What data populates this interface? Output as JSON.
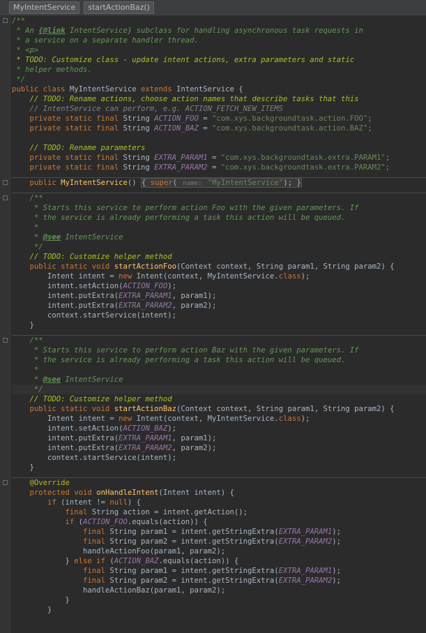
{
  "breadcrumbs": {
    "class_name": "MyIntentService",
    "method_name": "startActionBaz()"
  },
  "code": {
    "l1": "/**",
    "l2a": " * An ",
    "l2b": "{@link",
    "l2c": " IntentService}",
    "l2d": " subclass for handling asynchronous task requests in",
    "l3": " * a service on a separate handler thread.",
    "l4": " * <p>",
    "l5": " * TODO: Customize class - update intent actions, extra parameters and static",
    "l6": " * helper methods.",
    "l7": " */",
    "kw_public_class": "public class ",
    "class_name": "MyIntentService",
    "kw_extends": " extends ",
    "super_class": "IntentService {",
    "todo_rename_actions": "    // TODO: Rename actions, choose action names that describe tasks that this",
    "cm_intentservice": "    // IntentService can perform, e.g. ACTION_FETCH_NEW_ITEMS",
    "kw_psf": "    private static final ",
    "type_string": "String ",
    "action_foo": "ACTION_FOO",
    "action_baz": "ACTION_BAZ",
    "eq": " = ",
    "str_action_foo": "\"com.xys.backgroundtask.action.FOO\"",
    "str_action_baz": "\"com.xys.backgroundtask.action.BAZ\"",
    "semi": ";",
    "todo_rename_params": "    // TODO: Rename parameters",
    "extra_param1": "EXTRA_PARAM1",
    "extra_param2": "EXTRA_PARAM2",
    "str_param1": "\"com.xys.backgroundtask.extra.PARAM1\"",
    "str_param2": "\"com.xys.backgroundtask.extra.PARAM2\"",
    "kw_public": "    public ",
    "ctor_name": "MyIntentService",
    "ctor_open": "() ",
    "ctor_body_a": "{ ",
    "kw_super": "super",
    "paren_open": "( ",
    "hint_name": "name:",
    "str_ctor": " \"MyIntentService\"",
    "ctor_body_b": "); }",
    "doc_open": "    /**",
    "doc_foo1": "     * Starts this service to perform action Foo with the given parameters. If",
    "doc_foo2": "     * the service is already performing a task this action will be queued.",
    "doc_star": "     *",
    "doc_see_a": "     * ",
    "doc_see_tag": "@see",
    "doc_see_b": " IntentService",
    "doc_close": "     */",
    "todo_helper": "    // TODO: Customize helper method",
    "kw_public_static_void": "    public static void ",
    "m_start_foo": "startActionFoo",
    "m_start_baz": "startActionBaz",
    "m_params": "(Context context, String param1, String param2) {",
    "intent_a": "        Intent intent = ",
    "kw_new": "new ",
    "intent_b": "Intent(context, MyIntentService.",
    "kw_class": "class",
    "intent_c": ");",
    "set_action_a": "        intent.setAction(",
    "close_semi": ");",
    "put_extra_a": "        intent.putExtra(",
    "put_extra_p1": ", param1);",
    "put_extra_p2": ", param2);",
    "start_service": "        context.startService(intent);",
    "close_method": "    }",
    "doc_baz1": "     * Starts this service to perform action Baz with the given parameters. If",
    "doc_baz2": "     * the service is already performing a task this action will be queued.",
    "ann_override": "    @Override",
    "kw_protected_void": "    protected void ",
    "m_on_handle": "onHandleIntent",
    "m_on_handle_params": "(Intent intent) {",
    "if_a": "        if ",
    "if_b": "(intent != ",
    "kw_null": "null",
    "if_c": ") {",
    "final_a": "            final ",
    "final_action_b": "String action = intent.getAction();",
    "if2_a": "            if ",
    "if2_b": "(",
    "if2_c": ".equals(action)) {",
    "final2_a": "                final ",
    "p1_decl": "String param1 = intent.getStringExtra(",
    "p2_decl": "String param2 = intent.getStringExtra(",
    "handle_foo": "                handleActionFoo(param1, param2);",
    "else_a": "            } ",
    "kw_else": "else if ",
    "handle_baz": "                handleActionBaz(param1, param2);",
    "close_if": "            }",
    "close_outer_if": "        }"
  }
}
